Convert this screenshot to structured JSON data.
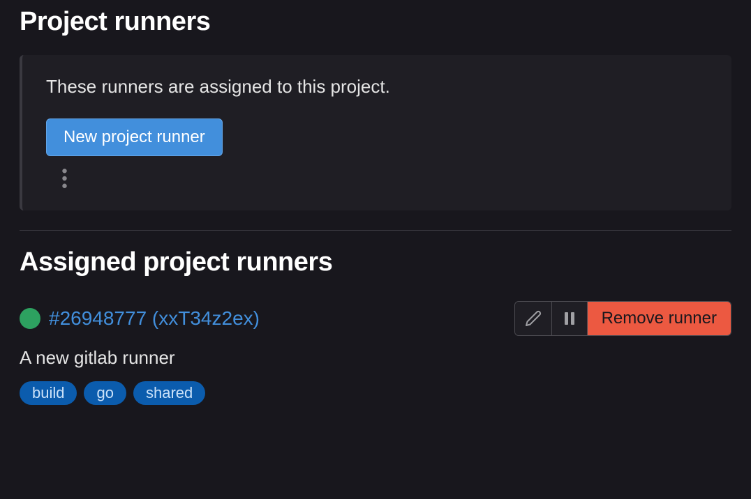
{
  "project_runners": {
    "title": "Project runners",
    "description": "These runners are assigned to this project.",
    "new_runner_label": "New project runner"
  },
  "assigned": {
    "title": "Assigned project runners",
    "runner": {
      "status_color": "#2da160",
      "id_token": "#26948777 (xxT34z2ex)",
      "description": "A new gitlab runner",
      "tags": [
        "build",
        "go",
        "shared"
      ]
    },
    "remove_label": "Remove runner"
  }
}
